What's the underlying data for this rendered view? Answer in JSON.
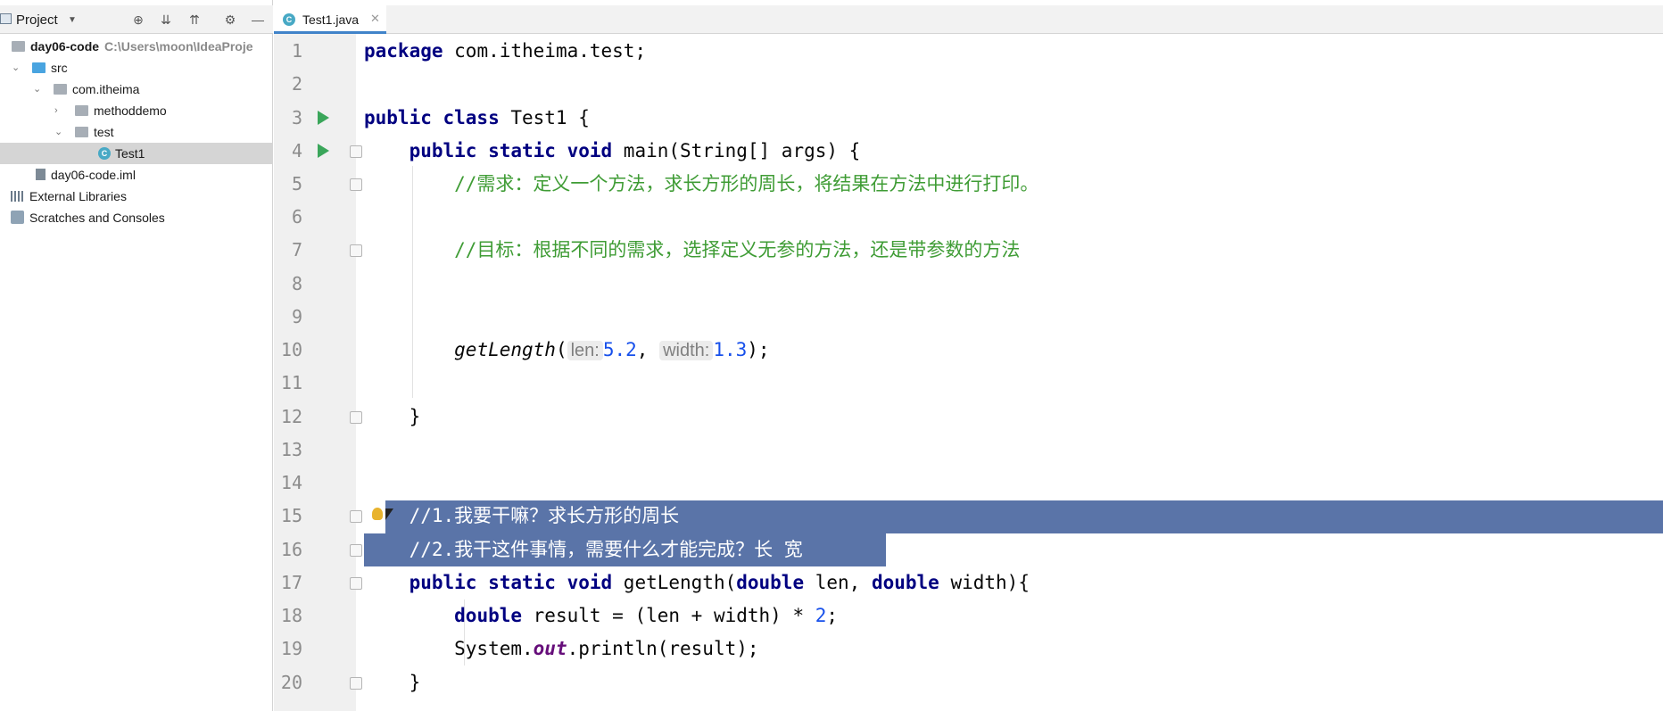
{
  "project_panel": {
    "title": "Project",
    "tree": [
      {
        "label": "day06-code",
        "path": "C:\\Users\\moon\\IdeaProje"
      },
      {
        "label": "src"
      },
      {
        "label": "com.itheima"
      },
      {
        "label": "methoddemo"
      },
      {
        "label": "test"
      },
      {
        "label": "Test1"
      },
      {
        "label": "day06-code.iml"
      },
      {
        "label": "External Libraries"
      },
      {
        "label": "Scratches and Consoles"
      }
    ]
  },
  "editor": {
    "tab_label": "Test1.java",
    "line_numbers": [
      "1",
      "2",
      "3",
      "4",
      "5",
      "6",
      "7",
      "8",
      "9",
      "10",
      "11",
      "12",
      "13",
      "14",
      "15",
      "16",
      "17",
      "18",
      "19",
      "20"
    ],
    "code": {
      "l1_kw": "package",
      "l1_rest": " com.itheima.test;",
      "l3_kw": "public class",
      "l3_rest": " Test1 {",
      "l4_indent": "    ",
      "l4_kw": "public static void",
      "l4_rest": " main(String[] args) {",
      "l5": "        //需求：定义一个方法，求长方形的周长，将结果在方法中进行打印。",
      "l7": "        //目标：根据不同的需求，选择定义无参的方法，还是带参数的方法",
      "l10_indent": "        ",
      "l10_method": "getLength",
      "l10_open": "(",
      "l10_hint1": "len:",
      "l10_arg1": "5.2",
      "l10_comma": ", ",
      "l10_hint2": "width:",
      "l10_arg2": "1.3",
      "l10_close": ");",
      "l12": "    }",
      "l15": "    //1.我要干嘛？求长方形的周长",
      "l16": "    //2.我干这件事情，需要什么才能完成？长 宽",
      "l17_indent": "    ",
      "l17_kw1": "public static void",
      "l17_a": " getLength(",
      "l17_kw2": "double",
      "l17_b": " len, ",
      "l17_kw3": "double",
      "l17_c": " width){",
      "l18_indent": "        ",
      "l18_kw": "double",
      "l18_a": " result = (len + width) * ",
      "l18_num": "2",
      "l18_b": ";",
      "l19_a": "        System.",
      "l19_field": "out",
      "l19_b": ".println(result);",
      "l20": "    }"
    }
  },
  "colors": {
    "keyword": "#000080",
    "comment": "#3f9c35",
    "number": "#1750eb",
    "selection": "#5a74a8",
    "run_icon": "#3aa65a"
  }
}
